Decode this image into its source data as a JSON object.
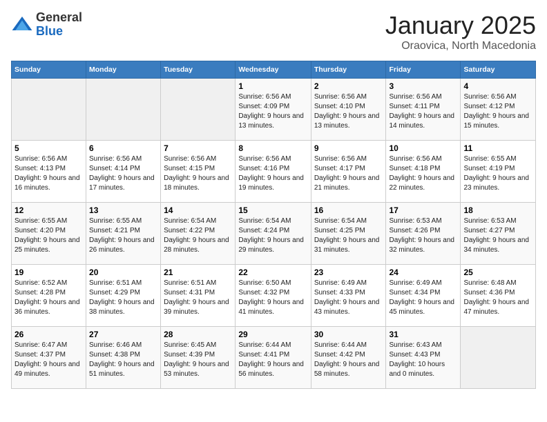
{
  "header": {
    "logo_general": "General",
    "logo_blue": "Blue",
    "month": "January 2025",
    "location": "Oraovica, North Macedonia"
  },
  "days_of_week": [
    "Sunday",
    "Monday",
    "Tuesday",
    "Wednesday",
    "Thursday",
    "Friday",
    "Saturday"
  ],
  "weeks": [
    [
      {
        "day": "",
        "info": ""
      },
      {
        "day": "",
        "info": ""
      },
      {
        "day": "",
        "info": ""
      },
      {
        "day": "1",
        "info": "Sunrise: 6:56 AM\nSunset: 4:09 PM\nDaylight: 9 hours and 13 minutes."
      },
      {
        "day": "2",
        "info": "Sunrise: 6:56 AM\nSunset: 4:10 PM\nDaylight: 9 hours and 13 minutes."
      },
      {
        "day": "3",
        "info": "Sunrise: 6:56 AM\nSunset: 4:11 PM\nDaylight: 9 hours and 14 minutes."
      },
      {
        "day": "4",
        "info": "Sunrise: 6:56 AM\nSunset: 4:12 PM\nDaylight: 9 hours and 15 minutes."
      }
    ],
    [
      {
        "day": "5",
        "info": "Sunrise: 6:56 AM\nSunset: 4:13 PM\nDaylight: 9 hours and 16 minutes."
      },
      {
        "day": "6",
        "info": "Sunrise: 6:56 AM\nSunset: 4:14 PM\nDaylight: 9 hours and 17 minutes."
      },
      {
        "day": "7",
        "info": "Sunrise: 6:56 AM\nSunset: 4:15 PM\nDaylight: 9 hours and 18 minutes."
      },
      {
        "day": "8",
        "info": "Sunrise: 6:56 AM\nSunset: 4:16 PM\nDaylight: 9 hours and 19 minutes."
      },
      {
        "day": "9",
        "info": "Sunrise: 6:56 AM\nSunset: 4:17 PM\nDaylight: 9 hours and 21 minutes."
      },
      {
        "day": "10",
        "info": "Sunrise: 6:56 AM\nSunset: 4:18 PM\nDaylight: 9 hours and 22 minutes."
      },
      {
        "day": "11",
        "info": "Sunrise: 6:55 AM\nSunset: 4:19 PM\nDaylight: 9 hours and 23 minutes."
      }
    ],
    [
      {
        "day": "12",
        "info": "Sunrise: 6:55 AM\nSunset: 4:20 PM\nDaylight: 9 hours and 25 minutes."
      },
      {
        "day": "13",
        "info": "Sunrise: 6:55 AM\nSunset: 4:21 PM\nDaylight: 9 hours and 26 minutes."
      },
      {
        "day": "14",
        "info": "Sunrise: 6:54 AM\nSunset: 4:22 PM\nDaylight: 9 hours and 28 minutes."
      },
      {
        "day": "15",
        "info": "Sunrise: 6:54 AM\nSunset: 4:24 PM\nDaylight: 9 hours and 29 minutes."
      },
      {
        "day": "16",
        "info": "Sunrise: 6:54 AM\nSunset: 4:25 PM\nDaylight: 9 hours and 31 minutes."
      },
      {
        "day": "17",
        "info": "Sunrise: 6:53 AM\nSunset: 4:26 PM\nDaylight: 9 hours and 32 minutes."
      },
      {
        "day": "18",
        "info": "Sunrise: 6:53 AM\nSunset: 4:27 PM\nDaylight: 9 hours and 34 minutes."
      }
    ],
    [
      {
        "day": "19",
        "info": "Sunrise: 6:52 AM\nSunset: 4:28 PM\nDaylight: 9 hours and 36 minutes."
      },
      {
        "day": "20",
        "info": "Sunrise: 6:51 AM\nSunset: 4:29 PM\nDaylight: 9 hours and 38 minutes."
      },
      {
        "day": "21",
        "info": "Sunrise: 6:51 AM\nSunset: 4:31 PM\nDaylight: 9 hours and 39 minutes."
      },
      {
        "day": "22",
        "info": "Sunrise: 6:50 AM\nSunset: 4:32 PM\nDaylight: 9 hours and 41 minutes."
      },
      {
        "day": "23",
        "info": "Sunrise: 6:49 AM\nSunset: 4:33 PM\nDaylight: 9 hours and 43 minutes."
      },
      {
        "day": "24",
        "info": "Sunrise: 6:49 AM\nSunset: 4:34 PM\nDaylight: 9 hours and 45 minutes."
      },
      {
        "day": "25",
        "info": "Sunrise: 6:48 AM\nSunset: 4:36 PM\nDaylight: 9 hours and 47 minutes."
      }
    ],
    [
      {
        "day": "26",
        "info": "Sunrise: 6:47 AM\nSunset: 4:37 PM\nDaylight: 9 hours and 49 minutes."
      },
      {
        "day": "27",
        "info": "Sunrise: 6:46 AM\nSunset: 4:38 PM\nDaylight: 9 hours and 51 minutes."
      },
      {
        "day": "28",
        "info": "Sunrise: 6:45 AM\nSunset: 4:39 PM\nDaylight: 9 hours and 53 minutes."
      },
      {
        "day": "29",
        "info": "Sunrise: 6:44 AM\nSunset: 4:41 PM\nDaylight: 9 hours and 56 minutes."
      },
      {
        "day": "30",
        "info": "Sunrise: 6:44 AM\nSunset: 4:42 PM\nDaylight: 9 hours and 58 minutes."
      },
      {
        "day": "31",
        "info": "Sunrise: 6:43 AM\nSunset: 4:43 PM\nDaylight: 10 hours and 0 minutes."
      },
      {
        "day": "",
        "info": ""
      }
    ]
  ]
}
